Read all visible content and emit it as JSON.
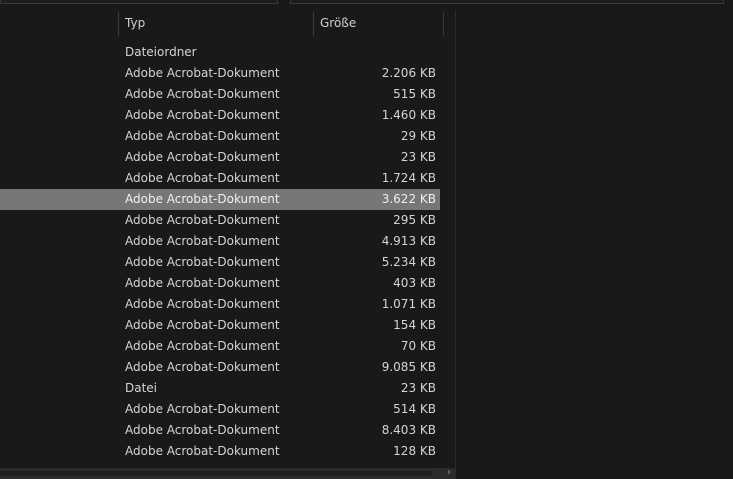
{
  "columns": {
    "type": "Typ",
    "size": "Größe"
  },
  "rows": [
    {
      "type": "Dateiordner",
      "size": ""
    },
    {
      "type": "Adobe Acrobat-Dokument",
      "size": "2.206 KB"
    },
    {
      "type": "Adobe Acrobat-Dokument",
      "size": "515 KB"
    },
    {
      "type": "Adobe Acrobat-Dokument",
      "size": "1.460 KB"
    },
    {
      "type": "Adobe Acrobat-Dokument",
      "size": "29 KB"
    },
    {
      "type": "Adobe Acrobat-Dokument",
      "size": "23 KB"
    },
    {
      "type": "Adobe Acrobat-Dokument",
      "size": "1.724 KB"
    },
    {
      "type": "Adobe Acrobat-Dokument",
      "size": "3.622 KB",
      "selected": true
    },
    {
      "type": "Adobe Acrobat-Dokument",
      "size": "295 KB"
    },
    {
      "type": "Adobe Acrobat-Dokument",
      "size": "4.913 KB"
    },
    {
      "type": "Adobe Acrobat-Dokument",
      "size": "5.234 KB"
    },
    {
      "type": "Adobe Acrobat-Dokument",
      "size": "403 KB"
    },
    {
      "type": "Adobe Acrobat-Dokument",
      "size": "1.071 KB"
    },
    {
      "type": "Adobe Acrobat-Dokument",
      "size": "154 KB"
    },
    {
      "type": "Adobe Acrobat-Dokument",
      "size": "70 KB"
    },
    {
      "type": "Adobe Acrobat-Dokument",
      "size": "9.085 KB"
    },
    {
      "type": "Datei",
      "size": "23 KB"
    },
    {
      "type": "Adobe Acrobat-Dokument",
      "size": "514 KB"
    },
    {
      "type": "Adobe Acrobat-Dokument",
      "size": "8.403 KB"
    },
    {
      "type": "Adobe Acrobat-Dokument",
      "size": "128 KB"
    }
  ],
  "scrollbar": {
    "arrow_icon": "chevron-right-icon",
    "arrow_glyph": "›"
  },
  "colors": {
    "background": "#191919",
    "selected_row": "#777777",
    "text": "#d4d4d4"
  }
}
